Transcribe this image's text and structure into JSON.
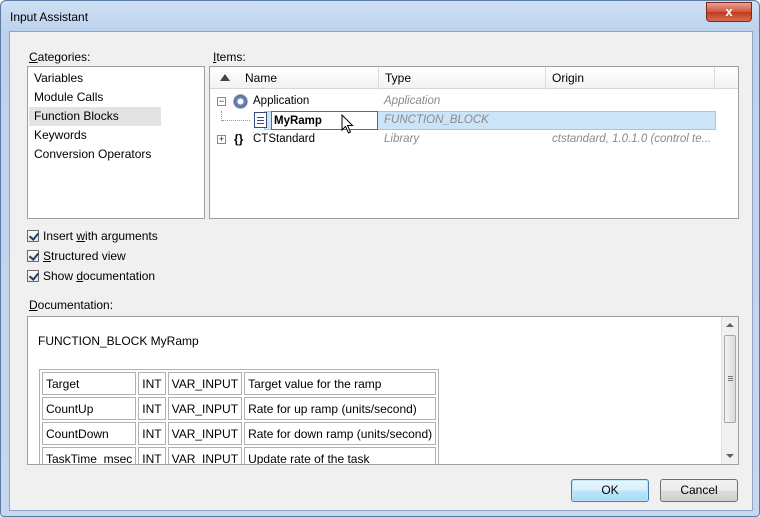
{
  "window": {
    "title": "Input Assistant",
    "close_glyph": "x"
  },
  "categories": {
    "label_prefix": "",
    "label_mnemonic": "C",
    "label_rest": "ategories:",
    "items": [
      {
        "label": "Variables"
      },
      {
        "label": "Module Calls"
      },
      {
        "label": "Function Blocks",
        "selected": true
      },
      {
        "label": "Keywords"
      },
      {
        "label": "Conversion Operators"
      }
    ]
  },
  "items": {
    "label_mnemonic": "I",
    "label_rest": "tems:",
    "columns": {
      "name": "Name",
      "type": "Type",
      "origin": "Origin"
    },
    "rows": [
      {
        "expander": "−",
        "icon": "gear-icon",
        "name": "Application",
        "type": "Application",
        "origin": ""
      },
      {
        "expander": "",
        "icon": "document-icon",
        "name": "MyRamp",
        "type": "FUNCTION_BLOCK",
        "origin": "",
        "selected": true
      },
      {
        "expander": "+",
        "icon": "braces-icon",
        "name": "CTStandard",
        "type": "Library",
        "origin": "ctstandard, 1.0.1.0 (control te..."
      }
    ]
  },
  "options": {
    "insert_with_arguments": {
      "pre": "Insert ",
      "mnemonic": "w",
      "post": "ith arguments",
      "checked": true
    },
    "structured_view": {
      "pre": "",
      "mnemonic": "S",
      "post": "tructured view",
      "checked": true
    },
    "show_documentation": {
      "pre": "Show ",
      "mnemonic": "d",
      "post": "ocumentation",
      "checked": true
    }
  },
  "documentation": {
    "label_mnemonic": "D",
    "label_rest": "ocumentation:",
    "title": "FUNCTION_BLOCK MyRamp",
    "rows": [
      {
        "name": "Target",
        "type": "INT",
        "kind": "VAR_INPUT",
        "desc": "Target value for the ramp"
      },
      {
        "name": "CountUp",
        "type": "INT",
        "kind": "VAR_INPUT",
        "desc": "Rate for up ramp (units/second)"
      },
      {
        "name": "CountDown",
        "type": "INT",
        "kind": "VAR_INPUT",
        "desc": "Rate for down ramp (units/second)"
      },
      {
        "name": "TaskTime_msec",
        "type": "INT",
        "kind": "VAR_INPUT",
        "desc": "Update rate of the task"
      }
    ]
  },
  "buttons": {
    "ok": "OK",
    "cancel": "Cancel"
  }
}
